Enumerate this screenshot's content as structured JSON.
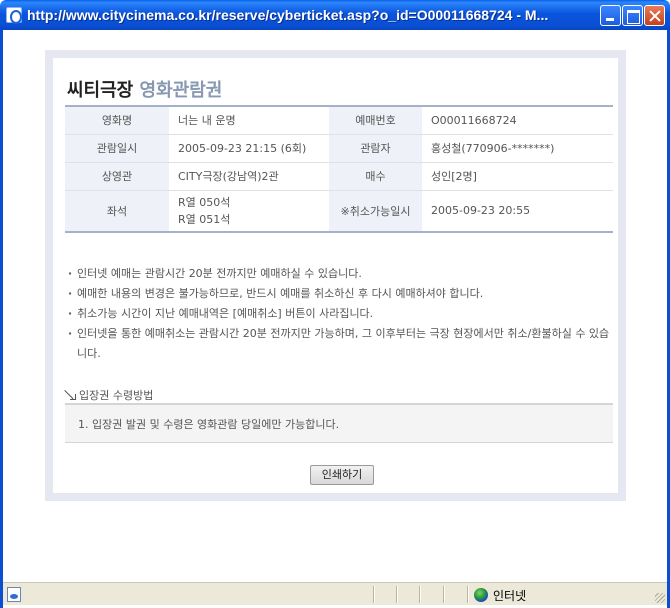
{
  "window": {
    "title": "http://www.citycinema.co.kr/reserve/cyberticket.asp?o_id=O00011668724 - M..."
  },
  "ticket": {
    "brand": "씨티극장",
    "title": "영화관람권",
    "rows": [
      {
        "label1": "영화명",
        "value1": "너는 내 운명",
        "label2": "예매번호",
        "value2": "O00011668724"
      },
      {
        "label1": "관람일시",
        "value1": "2005-09-23 21:15 (6회)",
        "label2": "관람자",
        "value2": "홍성철(770906-*******)"
      },
      {
        "label1": "상영관",
        "value1": "CITY극장(강남역)2관",
        "label2": "매수",
        "value2": "성인[2명]"
      },
      {
        "label1": "좌석",
        "value1a": "R열 050석",
        "value1b": "R열 051석",
        "label2": "※취소가능일시",
        "value2": "2005-09-23 20:55"
      }
    ]
  },
  "notes": [
    "인터넷 예매는 관람시간 20분 전까지만 예매하실 수 있습니다.",
    "예매한 내용의 변경은 불가능하므로, 반드시 예매를 취소하신 후 다시 예매하셔야 합니다.",
    "취소가능 시간이 지난 예매내역은 [예매취소] 버튼이 사라집니다.",
    "인터넷을 통한 예매취소는 관람시간 20분 전까지만 가능하며, 그 이후부터는 극장 현장에서만 취소/환불하실 수 있습니다."
  ],
  "method": {
    "title": "입장권 수령방법",
    "text": "1. 입장권 발권 및 수령은 영화관람 당일에만 가능합니다."
  },
  "actions": {
    "print_label": "인쇄하기"
  },
  "statusbar": {
    "zone": "인터넷"
  }
}
